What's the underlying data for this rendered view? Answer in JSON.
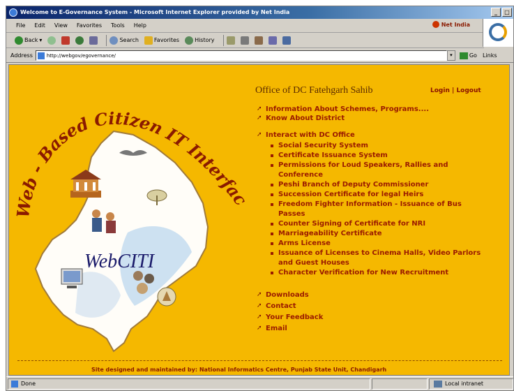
{
  "window": {
    "title": "Welcome to E-Governance System - Microsoft Internet Explorer provided by Net India",
    "controls": [
      "minimize",
      "maximize",
      "close"
    ]
  },
  "menubar": {
    "items": [
      "File",
      "Edit",
      "View",
      "Favorites",
      "Tools",
      "Help"
    ],
    "brand": "Net India"
  },
  "toolbar": {
    "back": "Back",
    "search": "Search",
    "favorites": "Favorites",
    "history": "History"
  },
  "address": {
    "label": "Address",
    "url": "http://webgov/egovernance/",
    "go": "Go",
    "links": "Links"
  },
  "page": {
    "banner_text": "Web - Based Citizen IT Interface",
    "logo_text": "WebCITI",
    "office_title": "Office of DC Fatehgarh Sahib",
    "login": "Login",
    "logout": "Logout",
    "separator": "|",
    "menu": [
      "Information About Schemes, Programs....",
      "Know About District",
      "Interact with DC Office"
    ],
    "sub_items": [
      "Social Security System",
      "Certificate Issuance System",
      "Permissions for Loud Speakers, Rallies and Conference",
      "Peshi Branch of Deputy Commissioner",
      "Succession Certificate for legal Heirs",
      "Freedom Fighter Information - Issuance of Bus Passes",
      "Counter Signing of Certificate for NRI",
      "Marriageability Certificate",
      "Arms License",
      "Issuance of Licenses to Cinema Halls, Video Parlors and Guest Houses",
      "Character Verification for New Recruitment"
    ],
    "bottom_links": [
      "Downloads",
      "Contact",
      "Your Feedback",
      "Email"
    ],
    "footer": "Site designed and maintained by: National Informatics Centre, Punjab State Unit, Chandigarh"
  },
  "statusbar": {
    "left": "Done",
    "zone": "Local intranet"
  },
  "colors": {
    "page_bg": "#f5b800",
    "link": "#9a1a00",
    "title": "#5a2a00"
  }
}
